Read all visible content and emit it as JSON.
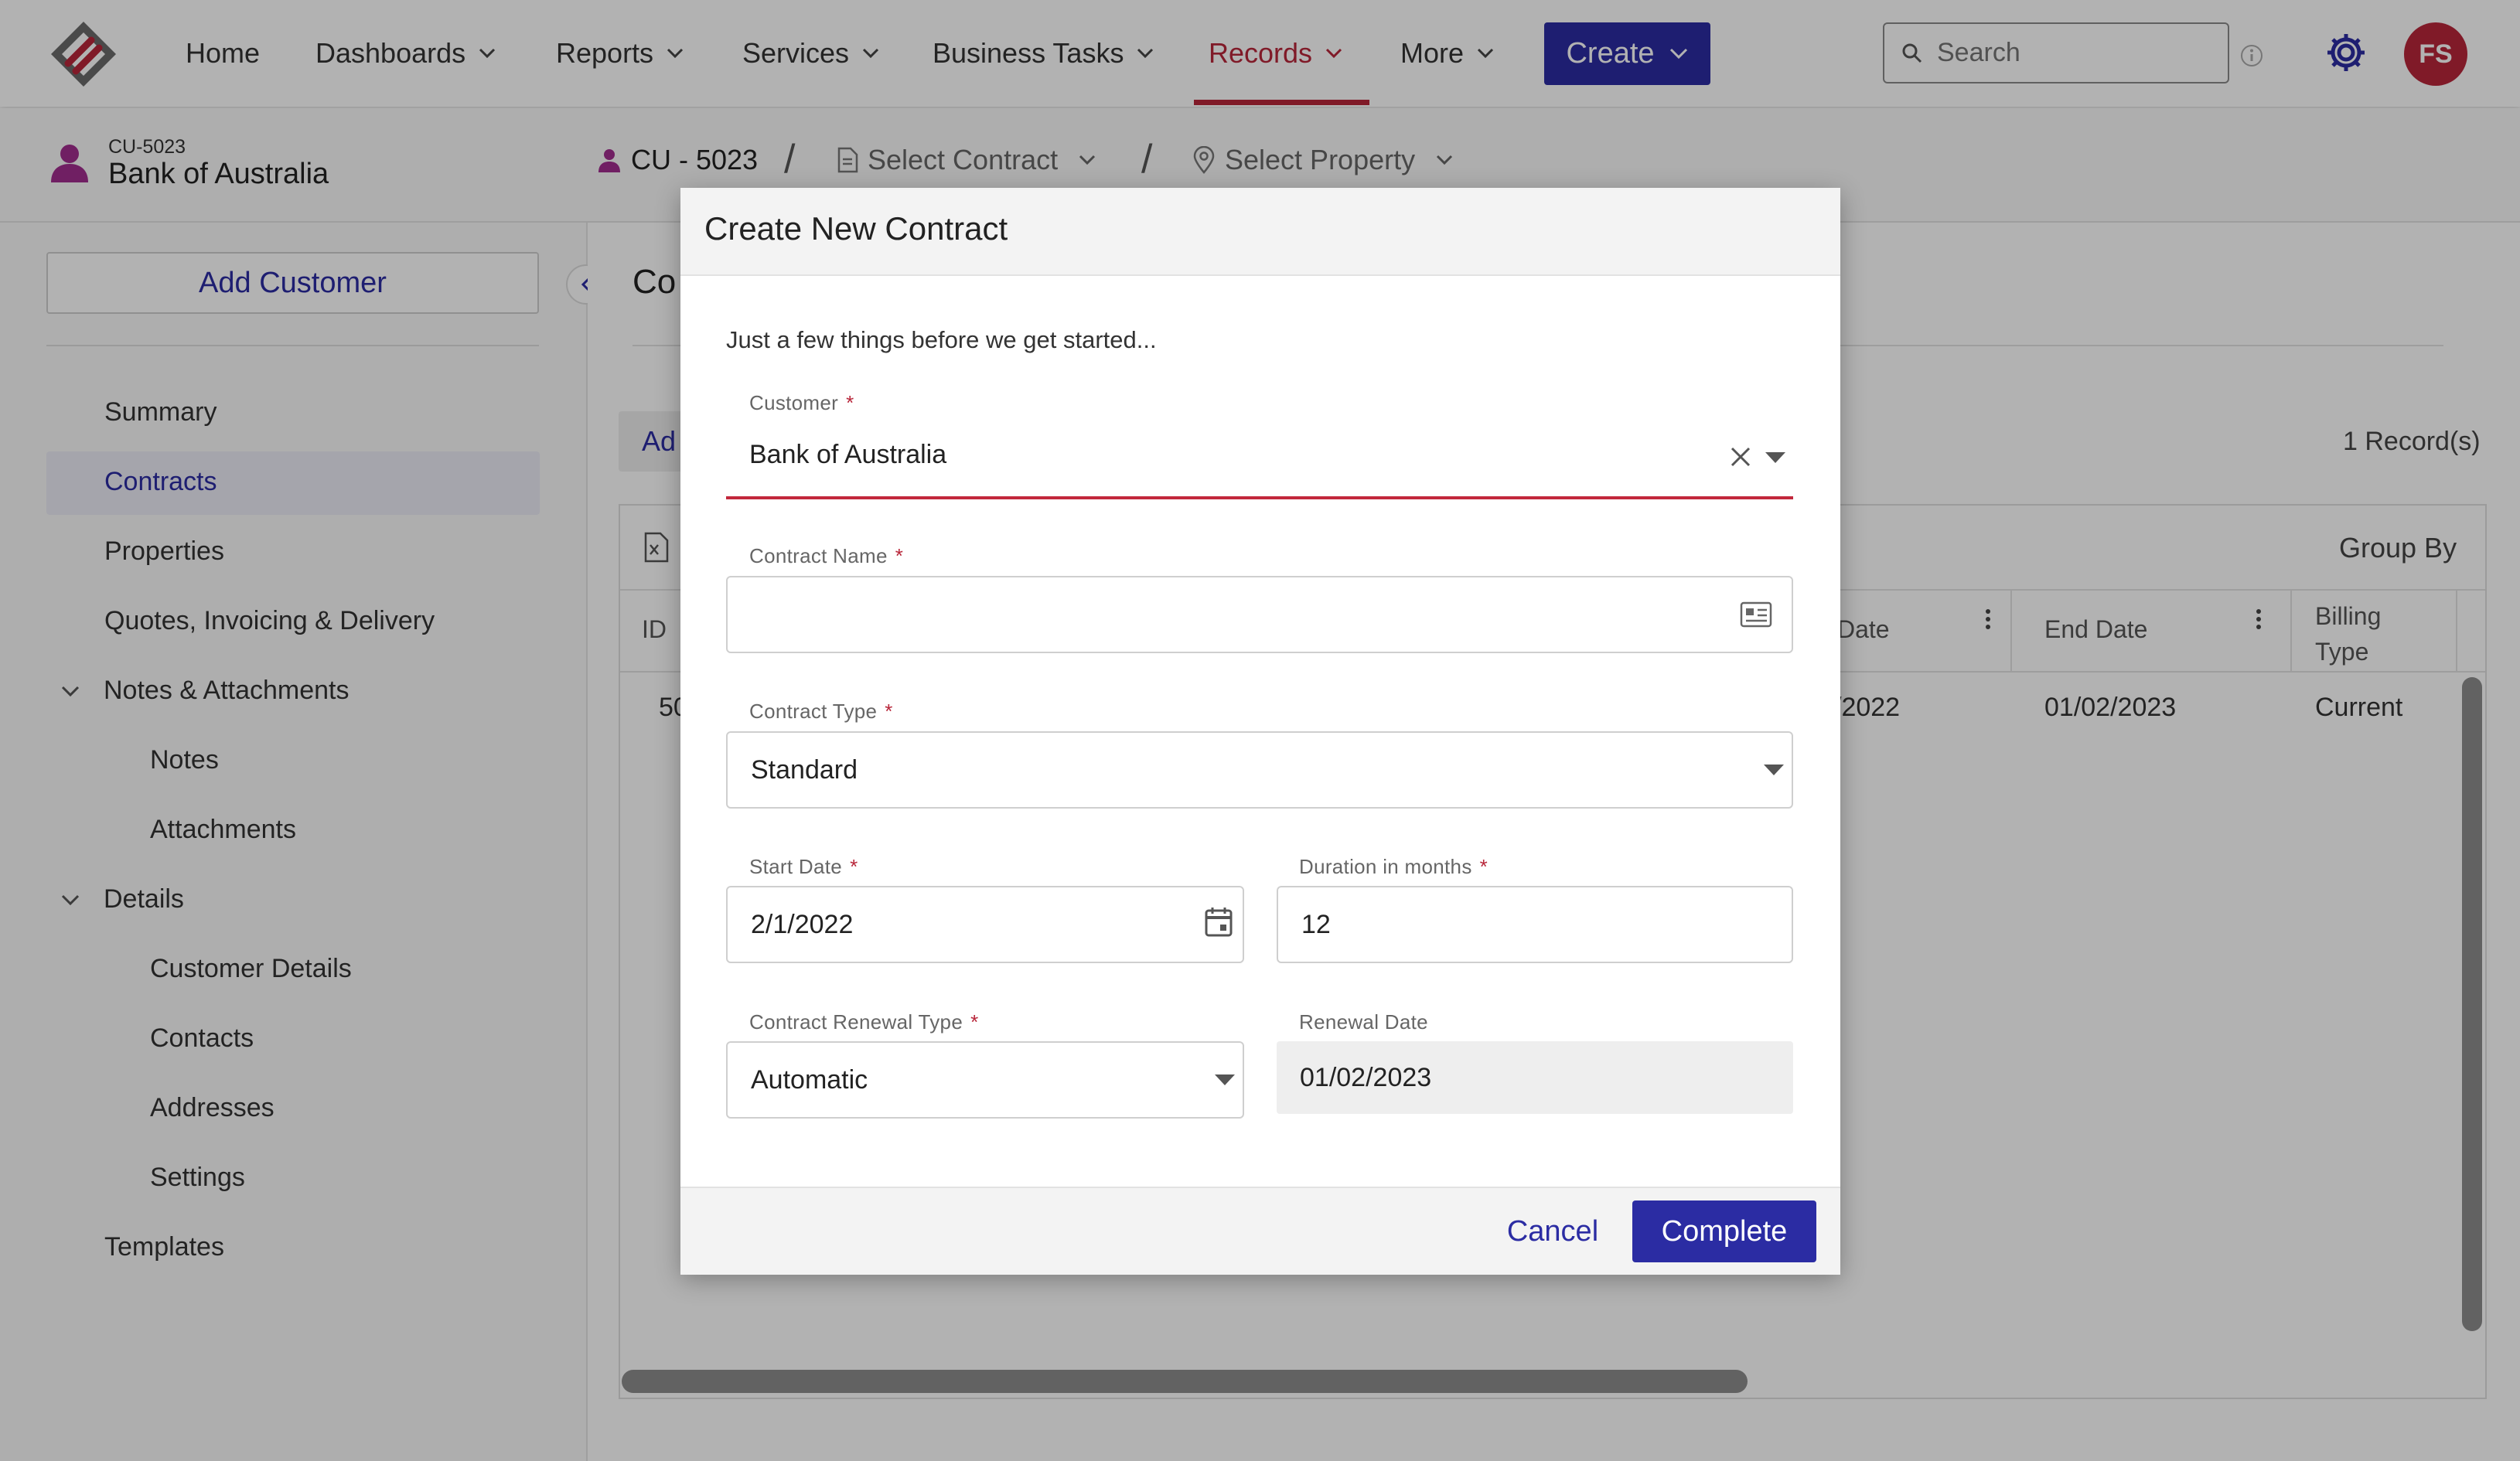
{
  "colors": {
    "accent": "#2b2ca3",
    "records_active": "#b8263a",
    "avatar_bg": "#b8263a",
    "error_underline": "#c2283c"
  },
  "topnav": {
    "items": [
      {
        "label": "Home",
        "has_dropdown": false
      },
      {
        "label": "Dashboards",
        "has_dropdown": true
      },
      {
        "label": "Reports",
        "has_dropdown": true
      },
      {
        "label": "Services",
        "has_dropdown": true
      },
      {
        "label": "Business Tasks",
        "has_dropdown": true
      },
      {
        "label": "Records",
        "has_dropdown": true,
        "active": true
      },
      {
        "label": "More",
        "has_dropdown": true
      }
    ],
    "create_label": "Create",
    "search_placeholder": "Search",
    "avatar_initials": "FS",
    "icons": [
      "app-logo-icon",
      "search-icon",
      "info-icon",
      "gear-icon",
      "chevron-down-icon"
    ]
  },
  "customer_header": {
    "customer_id": "CU-5023",
    "customer_name": "Bank of Australia",
    "breadcrumb": {
      "customer": "CU - 5023",
      "contract": "Select Contract",
      "property": "Select Property"
    }
  },
  "sidebar": {
    "add_customer_label": "Add Customer",
    "items": [
      {
        "label": "Summary"
      },
      {
        "label": "Contracts",
        "active": true
      },
      {
        "label": "Properties"
      },
      {
        "label": "Quotes, Invoicing & Delivery"
      },
      {
        "label": "Notes & Attachments",
        "expanded": true
      },
      {
        "label": "Notes"
      },
      {
        "label": "Attachments"
      },
      {
        "label": "Details",
        "expanded": true
      },
      {
        "label": "Customer Details"
      },
      {
        "label": "Contacts"
      },
      {
        "label": "Addresses"
      },
      {
        "label": "Settings"
      },
      {
        "label": "Templates"
      }
    ]
  },
  "main": {
    "heading_partial": "Co",
    "add_partial": "Ad",
    "record_count": "1 Record(s)",
    "group_by": "Group By",
    "columns": {
      "id": "ID",
      "start_partial": "Date",
      "end": "End Date",
      "billing_line1": "Billing",
      "billing_line2": "Type"
    },
    "row": {
      "id_partial": "50",
      "start_partial": "/2022",
      "end": "01/02/2023",
      "billing": "Current"
    }
  },
  "modal": {
    "title": "Create New Contract",
    "intro": "Just a few things before we get started...",
    "required_mark": "*",
    "fields": {
      "customer": {
        "label": "Customer",
        "value": "Bank of Australia"
      },
      "contract_name": {
        "label": "Contract Name",
        "value": ""
      },
      "contract_type": {
        "label": "Contract Type",
        "value": "Standard"
      },
      "start_date": {
        "label": "Start Date",
        "value": "2/1/2022"
      },
      "duration": {
        "label": "Duration in months",
        "value": "12"
      },
      "renewal_type": {
        "label": "Contract Renewal Type",
        "value": "Automatic"
      },
      "renewal_date": {
        "label": "Renewal Date",
        "value": "01/02/2023"
      }
    },
    "cancel_label": "Cancel",
    "complete_label": "Complete"
  }
}
